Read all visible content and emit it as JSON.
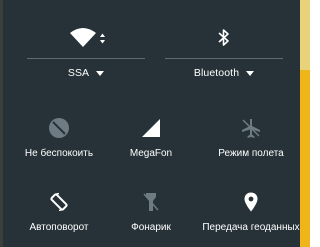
{
  "top_tiles": {
    "wifi": {
      "label": "SSA",
      "icon": "wifi-icon"
    },
    "bluetooth": {
      "label": "Bluetooth",
      "icon": "bluetooth-icon"
    }
  },
  "tiles": [
    {
      "label": "Не беспокоить",
      "icon": "do-not-disturb-icon",
      "active": false
    },
    {
      "label": "MegaFon",
      "icon": "cell-signal-icon",
      "active": true
    },
    {
      "label": "Режим полета",
      "icon": "airplane-icon",
      "active": false
    },
    {
      "label": "Автоповорот",
      "icon": "auto-rotate-icon",
      "active": true
    },
    {
      "label": "Фонарик",
      "icon": "flashlight-icon",
      "active": false
    },
    {
      "label": "Передача геоданных",
      "icon": "location-icon",
      "active": true
    }
  ],
  "colors": {
    "background": "#263238",
    "active_icon": "#ffffff",
    "inactive_icon": "#6e7b82",
    "divider": "#5f6b71"
  }
}
